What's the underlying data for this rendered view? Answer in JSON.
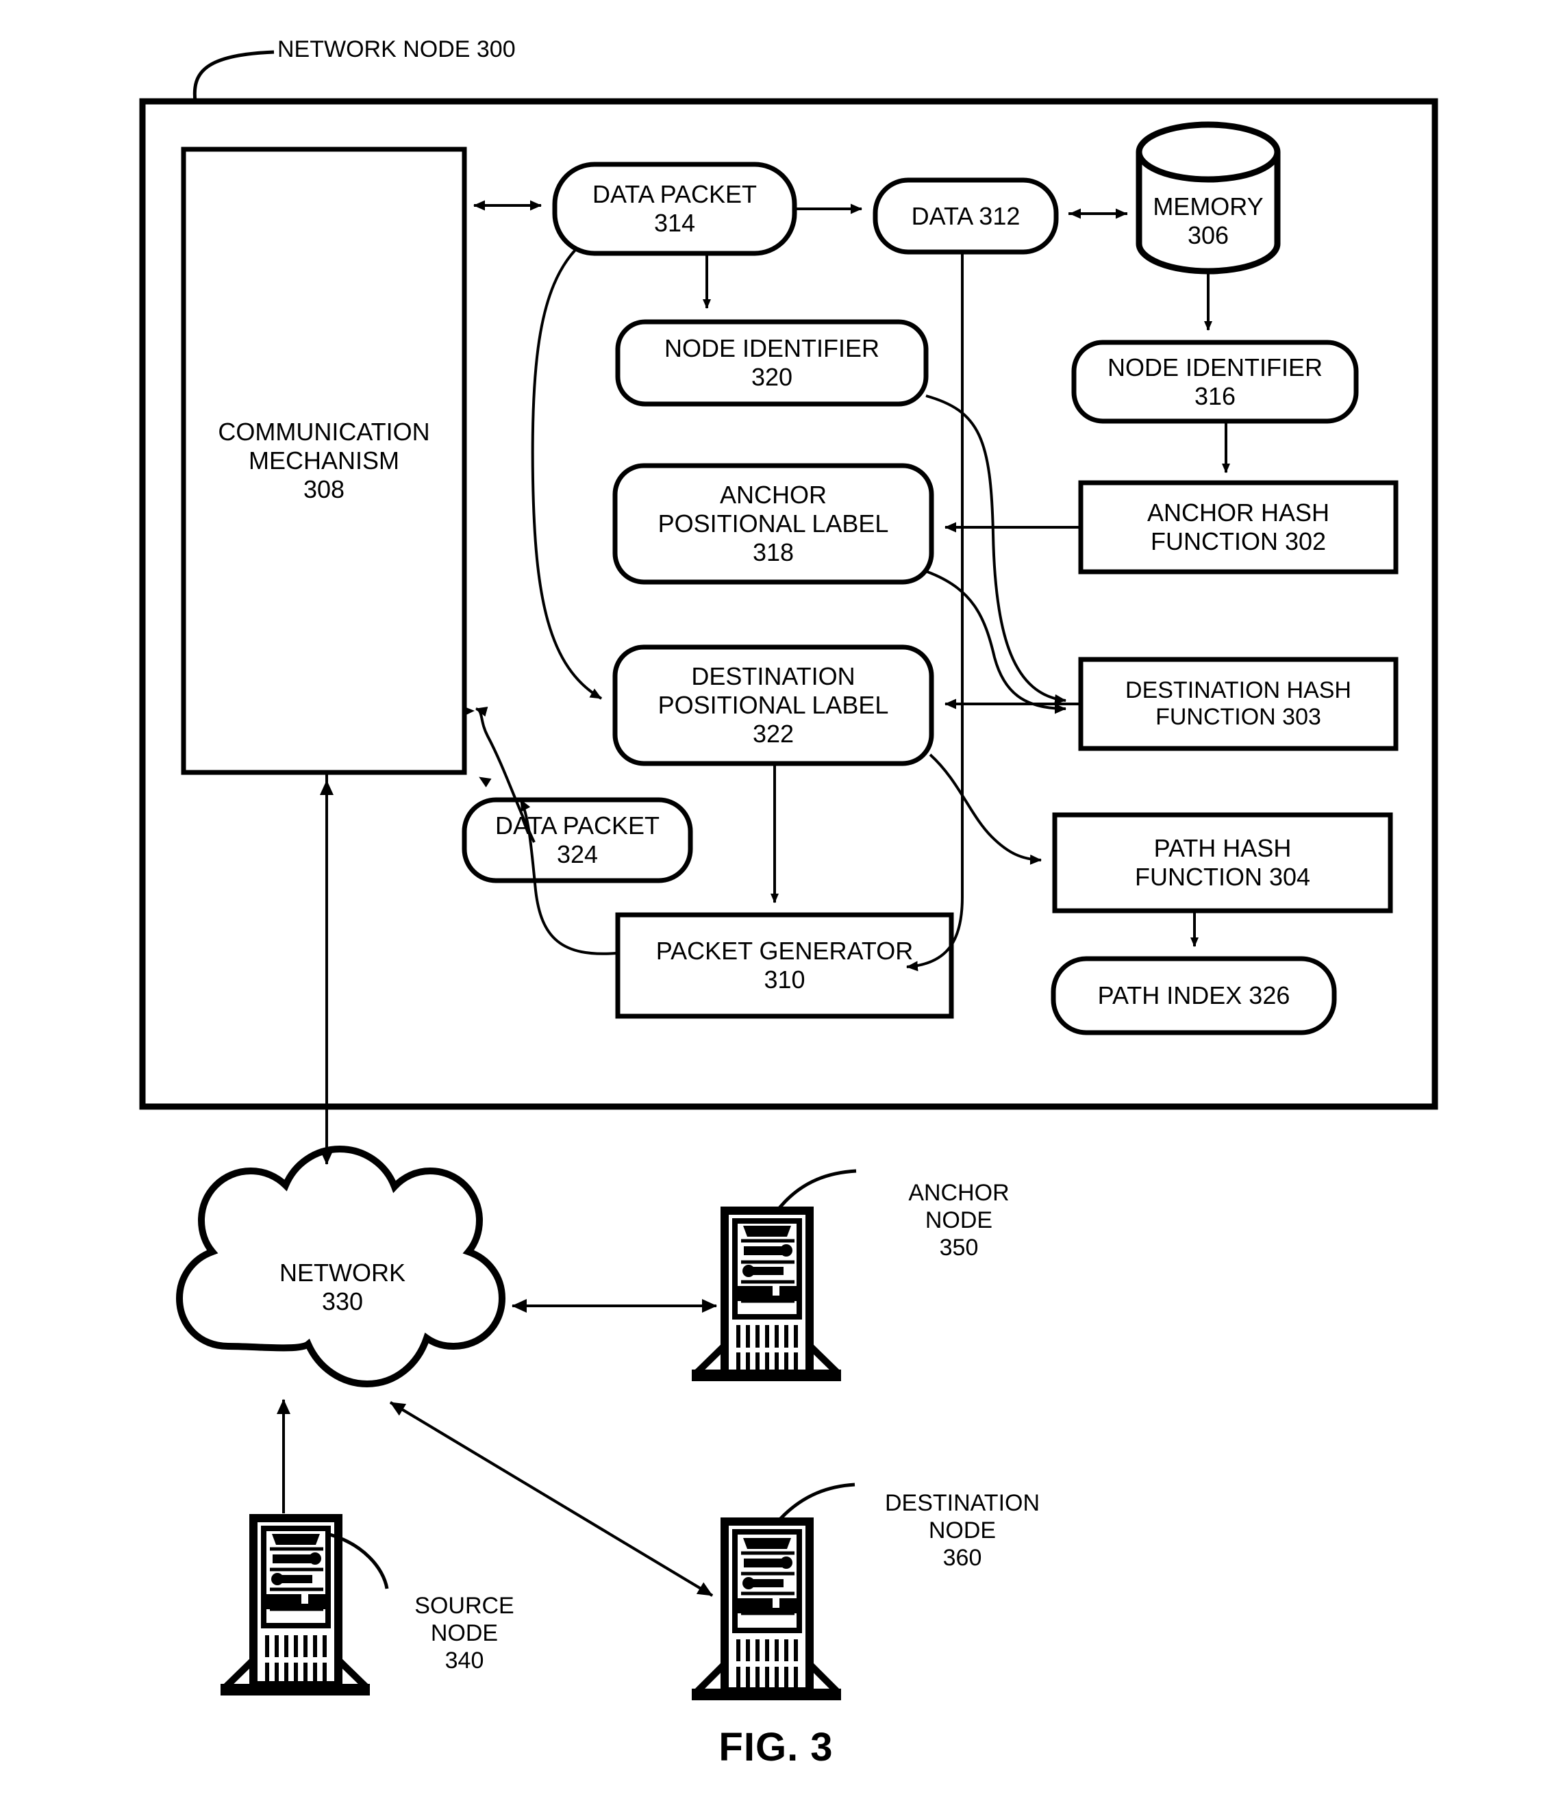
{
  "figure": {
    "caption": "FIG. 3",
    "outer_callout": "NETWORK NODE 300"
  },
  "node_box": {
    "title": "NETWORK NODE 300"
  },
  "blocks": {
    "communication_mechanism": {
      "line1": "COMMUNICATION",
      "line2": "MECHANISM",
      "line3": "308"
    },
    "data_packet_314": {
      "line1": "DATA PACKET",
      "line2": "314"
    },
    "data_312": {
      "line1": "DATA 312"
    },
    "memory_306": {
      "line1": "MEMORY",
      "line2": "306"
    },
    "node_identifier_320": {
      "line1": "NODE IDENTIFIER",
      "line2": "320"
    },
    "node_identifier_316": {
      "line1": "NODE IDENTIFIER",
      "line2": "316"
    },
    "anchor_positional_label_318": {
      "line1": "ANCHOR",
      "line2": "POSITIONAL LABEL",
      "line3": "318"
    },
    "anchor_hash_function_302": {
      "line1": "ANCHOR HASH",
      "line2": "FUNCTION 302"
    },
    "destination_positional_label_322": {
      "line1": "DESTINATION",
      "line2": "POSITIONAL LABEL",
      "line3": "322"
    },
    "destination_hash_function_303": {
      "line1": "DESTINATION HASH",
      "line2": "FUNCTION 303"
    },
    "data_packet_324": {
      "line1": "DATA PACKET",
      "line2": "324"
    },
    "packet_generator_310": {
      "line1": "PACKET GENERATOR",
      "line2": "310"
    },
    "path_hash_function_304": {
      "line1": "PATH HASH",
      "line2": "FUNCTION 304"
    },
    "path_index_326": {
      "line1": "PATH INDEX 326"
    },
    "network_330": {
      "line1": "NETWORK",
      "line2": "330"
    }
  },
  "callouts": {
    "anchor_node_350": {
      "line1": "ANCHOR",
      "line2": "NODE",
      "line3": "350"
    },
    "source_node_340": {
      "line1": "SOURCE",
      "line2": "NODE",
      "line3": "340"
    },
    "destination_node_360": {
      "line1": "DESTINATION",
      "line2": "NODE",
      "line3": "360"
    }
  },
  "colors": {
    "stroke": "#000000",
    "background": "#ffffff"
  },
  "reference_numerals": [
    "300",
    "302",
    "303",
    "304",
    "306",
    "308",
    "310",
    "312",
    "314",
    "316",
    "318",
    "320",
    "322",
    "324",
    "326",
    "330",
    "340",
    "350",
    "360"
  ]
}
